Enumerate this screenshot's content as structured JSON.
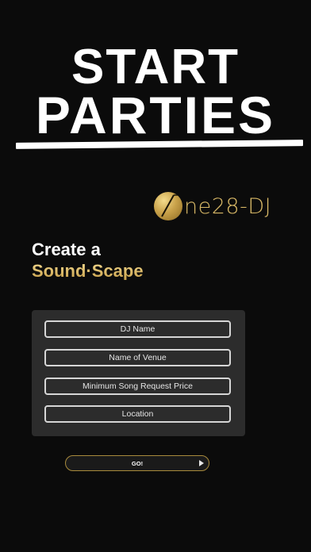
{
  "headline": {
    "line1": "START",
    "line2": "PARTIES"
  },
  "logo": {
    "text": "ne28-DJ",
    "full_name": "One28-DJ",
    "icon": "gold-circle-o-logo-icon",
    "color": "#d8b866"
  },
  "intro": {
    "line1": "Create a",
    "line2": "Sound·Scape"
  },
  "form": {
    "dj_name_placeholder": "DJ Name",
    "venue_placeholder": "Name of Venue",
    "price_placeholder": "Minimum Song Request Price",
    "location_placeholder": "Location"
  },
  "go_button": {
    "label": "GO!",
    "icon": "play-icon"
  },
  "colors": {
    "background": "#0b0b0b",
    "panel": "#2c2c2c",
    "gold": "#d9b868",
    "text": "#ffffff"
  }
}
